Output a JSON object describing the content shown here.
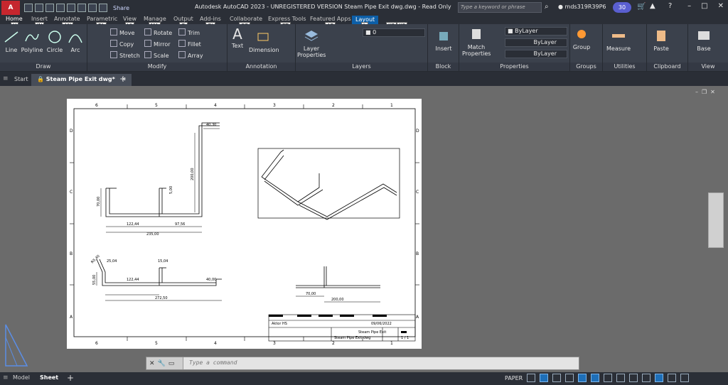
{
  "app": {
    "logo": "A",
    "title": "Autodesk AutoCAD 2023 - UNREGISTERED VERSION    Steam Pipe Exit dwg.dwg - Read Only",
    "share": "Share",
    "search_placeholder": "Type a keyword or phrase",
    "user": "mds319R39P6",
    "notifications": "30",
    "icons": [
      "search-icon",
      "user-icon",
      "cart-icon",
      "help-icon",
      "minimize-icon",
      "maximize-icon",
      "close-icon"
    ]
  },
  "ribbon_tabs": [
    "Home",
    "Insert",
    "Annotate",
    "Parametric",
    "View",
    "Manage",
    "Output",
    "Add-ins",
    "Collaborate",
    "Express Tools",
    "Featured Apps",
    "Layout"
  ],
  "active_tab": "Layout",
  "keytips": [
    "H",
    "IN",
    "AN",
    "PA",
    "VI",
    "MA",
    "O",
    "GI",
    "CO",
    "ET",
    "AP",
    "L",
    "X2",
    "X3"
  ],
  "ribbon": {
    "draw": {
      "title": "Draw",
      "tools": [
        "Line",
        "Polyline",
        "Circle",
        "Arc"
      ]
    },
    "modify": {
      "title": "Modify",
      "tools": [
        "Move",
        "Rotate",
        "Trim",
        "Copy",
        "Mirror",
        "Fillet",
        "Stretch",
        "Scale",
        "Array"
      ]
    },
    "annotation": {
      "title": "Annotation",
      "tools": [
        "Text",
        "Dimension"
      ]
    },
    "layers": {
      "title": "Layers",
      "tools": [
        "Layer Properties"
      ],
      "current_layer": "0"
    },
    "block": {
      "title": "Block",
      "tools": [
        "Insert"
      ]
    },
    "properties": {
      "title": "Properties",
      "tools": [
        "Match Properties"
      ],
      "color": "ByLayer",
      "linetype": "ByLayer",
      "lineweight": "ByLayer"
    },
    "groups": {
      "title": "Groups",
      "tools": [
        "Group"
      ]
    },
    "utilities": {
      "title": "Utilities",
      "tools": [
        "Measure"
      ]
    },
    "clipboard": {
      "title": "Clipboard",
      "tools": [
        "Paste"
      ]
    },
    "view": {
      "title": "View",
      "tools": [
        "Base"
      ]
    }
  },
  "doc_tabs": [
    "Start",
    "Steam Pipe Exit dwg*"
  ],
  "drawing": {
    "border_cols": [
      "6",
      "5",
      "4",
      "3",
      "2",
      "1"
    ],
    "border_rows": [
      "D",
      "C",
      "B",
      "A"
    ],
    "dims_top": [
      "40,30",
      "200,00",
      "70,00",
      "5,00",
      "122,44",
      "97,56",
      "235,00"
    ],
    "dims_bottom": [
      "25,04",
      "15,04",
      "55,00",
      "122,44",
      "40,00",
      "272,50",
      "R5,40"
    ],
    "dims_right": [
      "70,00",
      "200,00"
    ],
    "title_block": {
      "author": "Aktor HS",
      "date": "09/06/2022",
      "title": "Steam Pipe Exit",
      "filename": "Steam Pipe Exit dwg",
      "sheet_no": "1 / 1"
    }
  },
  "command": {
    "placeholder": "Type a command"
  },
  "status": {
    "layouts": [
      "Model",
      "Sheet"
    ],
    "active_layout": "Sheet",
    "space": "PAPER"
  }
}
